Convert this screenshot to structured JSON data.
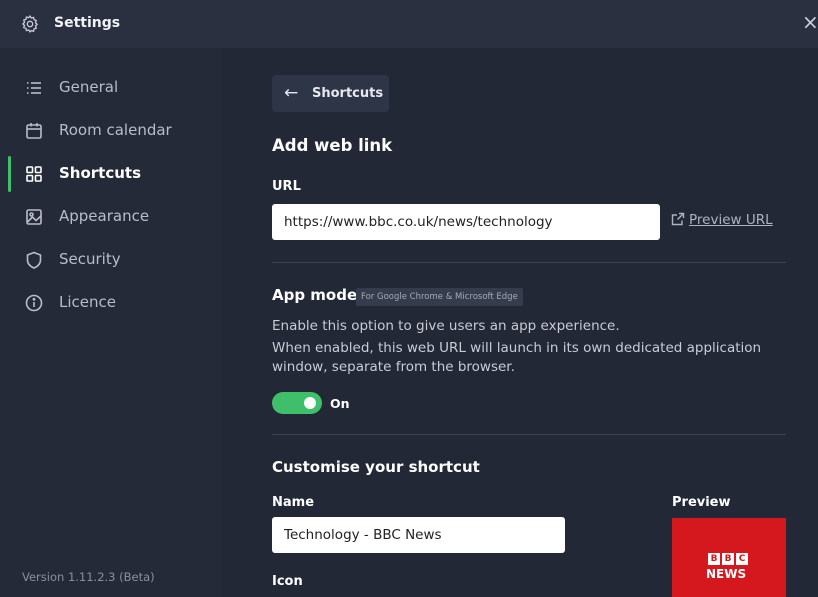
{
  "window": {
    "title": "Settings",
    "close_glyph": "×",
    "icons": {
      "settings": "gear-icon",
      "close": "close-icon"
    }
  },
  "sidebar": {
    "items": [
      {
        "label": "General",
        "icon": "list-icon",
        "active": false
      },
      {
        "label": "Room calendar",
        "icon": "calendar-icon",
        "active": false
      },
      {
        "label": "Shortcuts",
        "icon": "grid-icon",
        "active": true
      },
      {
        "label": "Appearance",
        "icon": "image-icon",
        "active": false
      },
      {
        "label": "Security",
        "icon": "shield-icon",
        "active": false
      },
      {
        "label": "Licence",
        "icon": "info-icon",
        "active": false
      }
    ],
    "version": "Version 1.11.2.3 (Beta)"
  },
  "main": {
    "back_button": {
      "arrow": "←",
      "label": "Shortcuts"
    },
    "heading": "Add web link",
    "url": {
      "label": "URL",
      "value": "https://www.bbc.co.uk/news/technology",
      "preview_link": "Preview URL"
    },
    "app_mode": {
      "heading": "App mode",
      "badge": "For Google Chrome & Microsoft Edge",
      "line1": "Enable this option to give users an app experience.",
      "line2": "When enabled, this web URL will launch in its own dedicated application",
      "line3": "window, separate from the browser.",
      "toggle_state": "On",
      "toggle_on": true
    },
    "customise": {
      "heading": "Customise your shortcut",
      "name_label": "Name",
      "name_value": "Technology - BBC News",
      "icon_label": "Icon",
      "preview_label": "Preview",
      "preview_logo": {
        "letters": [
          "B",
          "B",
          "C"
        ],
        "news": "NEWS"
      }
    }
  },
  "colors": {
    "accent": "#3fbf6a",
    "background": "#222836",
    "titlebar": "#2a3040",
    "preview_tile": "#d4181e"
  }
}
